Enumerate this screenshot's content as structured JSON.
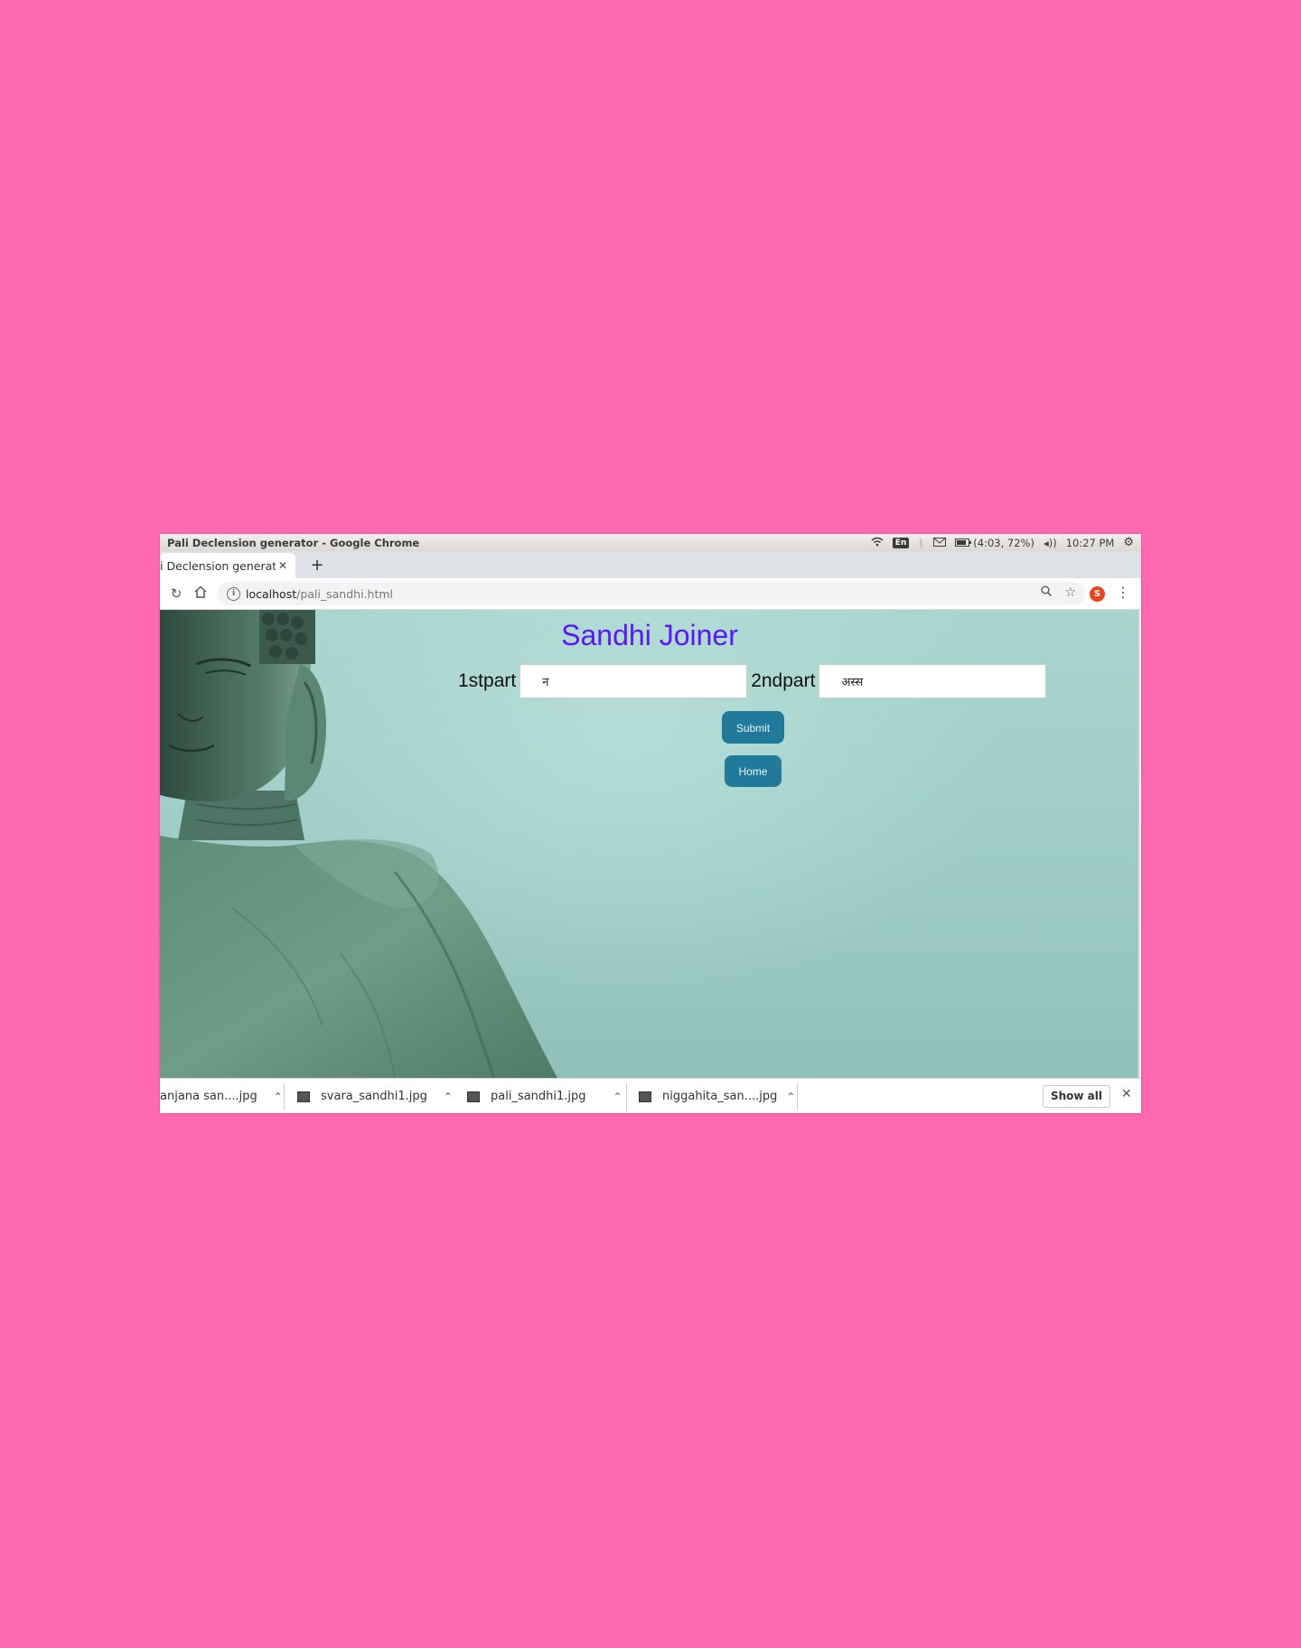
{
  "system_bar": {
    "window_title": "Pali Declension generator - Google Chrome",
    "keyboard_layout": "En",
    "battery": "(4:03, 72%)",
    "clock": "10:27 PM"
  },
  "browser": {
    "tab_title": "i Declension generator",
    "url_host": "localhost",
    "url_path": "/pali_sandhi.html",
    "extension_badge": "S"
  },
  "page": {
    "title": "Sandhi Joiner",
    "first_label": "1stpart",
    "first_value": "न",
    "second_label": "2ndpart",
    "second_value": "अस्स",
    "submit_label": "Submit",
    "home_label": "Home",
    "accent_color": "#5b18f4",
    "button_color": "#217a9a"
  },
  "downloads": {
    "items": [
      "anjana san....jpg",
      "svara_sandhi1.jpg",
      "pali_sandhi1.jpg",
      "niggahita_san....jpg"
    ],
    "show_all_label": "Show all"
  }
}
